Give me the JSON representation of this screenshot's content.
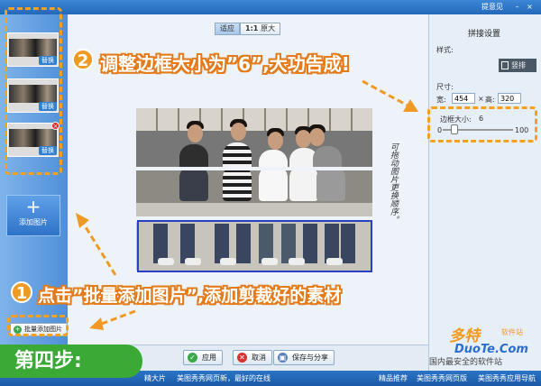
{
  "window": {
    "feedback": "提意见",
    "minimize": "–",
    "close": "×"
  },
  "sidebar": {
    "thumb_replace_label": "替换",
    "thumb_delete_mark": "×",
    "add_icon": "+",
    "add_label": "添加图片",
    "batch_add_label": "批量添加图片"
  },
  "canvas": {
    "zoom_fit": "适应",
    "zoom_original": "原大",
    "handwriting": "可拖动图片更换顺序。"
  },
  "settings": {
    "title": "拼接设置",
    "layout_label": "样式:",
    "vertical_label": "竖排",
    "size_label": "尺寸:",
    "width_label": "宽:",
    "width_value": "454",
    "height_label": "高:",
    "height_value": "320",
    "border_label": "边框大小:",
    "border_value": "6",
    "slider_min": "0",
    "slider_max": "100",
    "slider_level": 6
  },
  "actions": {
    "apply": "应用",
    "cancel": "取消",
    "save_share": "保存与分享"
  },
  "status_bar": {
    "item1": "美图秀秀网页新，最好的在线",
    "item2": "精品推荐",
    "item3": "美图秀秀网页版",
    "item4": "美图秀秀应用导航",
    "left_fragment": "精大片"
  },
  "annotations": {
    "step_label": "第四步:",
    "step1_num": "1",
    "step1_text": "点击”批量添加图片”,添加剪裁好的素材",
    "step2_num": "2",
    "step2_text": "调整边框大小为”6”,大功告成!"
  },
  "watermark": {
    "brand": "多特",
    "brand_sub": "软件站",
    "site": "DuoTe.Com",
    "slogan": "国内最安全的软件站"
  },
  "colors": {
    "accent_orange": "#f09a26",
    "step_green": "#3aa935",
    "title_blue": "#2468b8",
    "selection_blue": "#2a3fc6"
  }
}
